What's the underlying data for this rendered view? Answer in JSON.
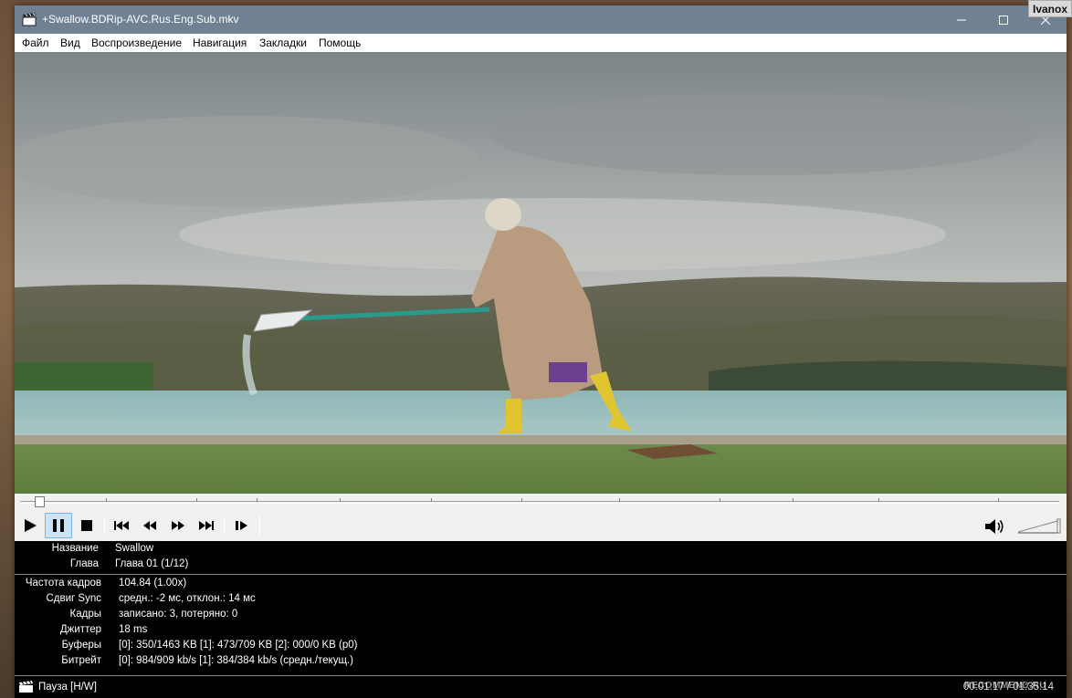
{
  "window": {
    "title": "+Swallow.BDRip-AVC.Rus.Eng.Sub.mkv",
    "user_badge": "Ivanox"
  },
  "menu": [
    "Файл",
    "Вид",
    "Воспроизведение",
    "Навигация",
    "Закладки",
    "Помощь"
  ],
  "playback": {
    "position_fraction": 0.009
  },
  "info": {
    "file": [
      {
        "label": "Название",
        "value": "Swallow"
      },
      {
        "label": "Глава",
        "value": "Глава 01 (1/12)"
      }
    ],
    "stats": [
      {
        "label": "Частота кадров",
        "value": "104.84 (1.00x)"
      },
      {
        "label": "Сдвиг Sync",
        "value": "средн.: -2 мс, отклон.: 14 мс"
      },
      {
        "label": "Кадры",
        "value": "записано: 3, потеряно: 0"
      },
      {
        "label": "Джиттер",
        "value": "18 ms"
      },
      {
        "label": "Буферы",
        "value": "[0]: 350/1463 KB [1]: 473/709 KB [2]: 000/0 KB (p0)"
      },
      {
        "label": "Битрейт",
        "value": "[0]: 984/909 kb/s [1]: 384/384 kb/s (средн./текущ.)"
      }
    ]
  },
  "status": {
    "text": "Пауза [H/W]",
    "time": "00:01:17 / 01:35:14",
    "watermark": "RECOMMEND.RU"
  },
  "colors": {
    "titlebar": "#6f8193",
    "info_bg": "#000000",
    "pause_active": "#cce4f7"
  },
  "icons": [
    "app-clapper-icon",
    "minimize-icon",
    "maximize-icon",
    "close-icon",
    "play-icon",
    "pause-icon",
    "stop-icon",
    "skip-back-icon",
    "rewind-icon",
    "fast-forward-icon",
    "skip-forward-icon",
    "frame-step-icon",
    "volume-icon"
  ]
}
